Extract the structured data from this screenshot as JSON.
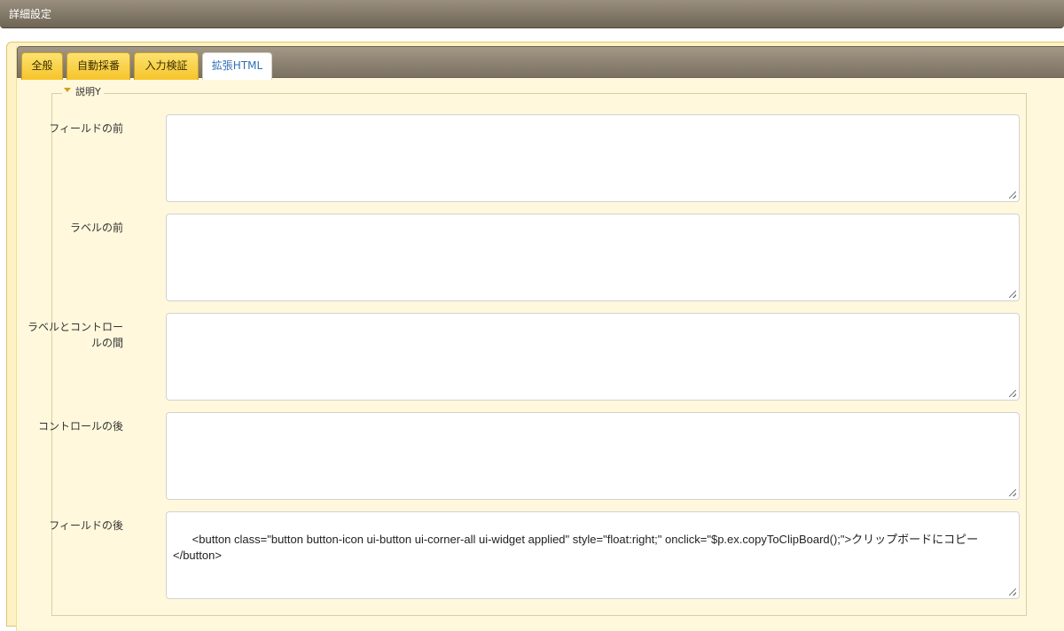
{
  "window": {
    "title": "詳細設定"
  },
  "tabs": [
    {
      "label": "全般",
      "active": false
    },
    {
      "label": "自動採番",
      "active": false
    },
    {
      "label": "入力検証",
      "active": false
    },
    {
      "label": "拡張HTML",
      "active": true
    }
  ],
  "section": {
    "legend": "説明Y",
    "expanded": true
  },
  "fields": [
    {
      "label_lines": [
        "フィールドの前"
      ],
      "value": ""
    },
    {
      "label_lines": [
        "ラベルの前"
      ],
      "value": ""
    },
    {
      "label_lines": [
        "ラベルとコントロー",
        "ルの間"
      ],
      "value": ""
    },
    {
      "label_lines": [
        "コントロールの後"
      ],
      "value": ""
    },
    {
      "label_lines": [
        "フィールドの後"
      ],
      "value": "<button class=\"button button-icon ui-button ui-corner-all ui-widget applied\" style=\"float:right;\" onclick=\"$p.ex.copyToClipBoard();\">クリップボードにコピー\n</button>"
    }
  ],
  "colors": {
    "title_bar": "#6e6554",
    "panel_background": "#fef2c4",
    "tab_background": "#f6c42a",
    "active_tab_text": "#2f6fb7",
    "legend_arrow": "#d4a017"
  }
}
